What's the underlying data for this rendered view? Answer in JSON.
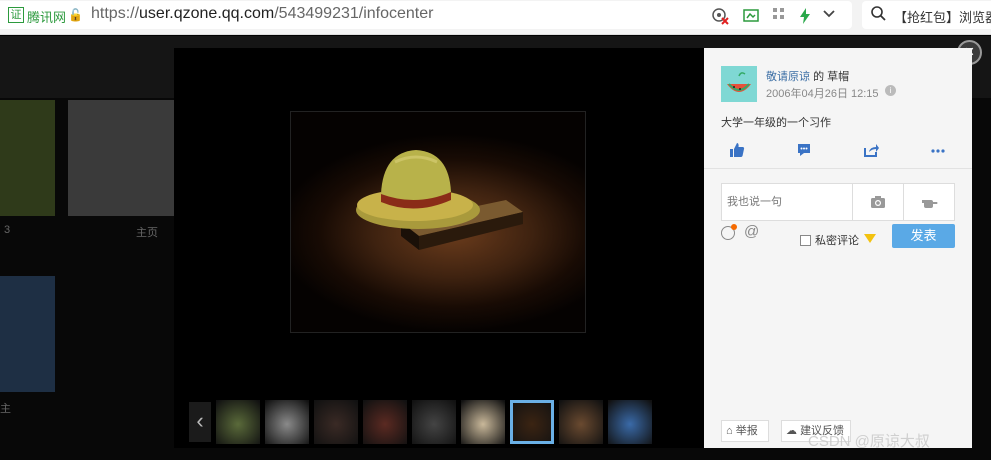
{
  "browser": {
    "cert_label": "腾讯网",
    "url_scheme": "https://",
    "url_host": "user.qzone.qq.com",
    "url_path": "/543499231/infocenter",
    "search_text": "【抢红包】浏览器"
  },
  "background_page": {
    "labels": [
      "3",
      "主页",
      "主"
    ]
  },
  "viewer": {
    "prev_glyph": "‹",
    "thumbnails": [
      {
        "name": "yellow-car",
        "color": "#5a6a3a"
      },
      {
        "name": "robot",
        "color": "#8a8a8a"
      },
      {
        "name": "dark-scene",
        "color": "#3a2a25"
      },
      {
        "name": "creature",
        "color": "#5b2a22"
      },
      {
        "name": "machine",
        "color": "#444444"
      },
      {
        "name": "toy-figures",
        "color": "#c9b89a"
      },
      {
        "name": "straw-hat",
        "color": "#3b2412",
        "active": true
      },
      {
        "name": "cartoon",
        "color": "#6a4a30"
      },
      {
        "name": "ship",
        "color": "#3a6aa8"
      }
    ]
  },
  "panel": {
    "author": "敬请原谅",
    "author_of": "的",
    "album": "草帽",
    "timestamp": "2006年04月26日 12:15",
    "caption": "大学一年级的一个习作",
    "comment_placeholder": "我也说一句",
    "private_label": "私密评论",
    "submit_label": "发表",
    "report_label": "举报",
    "feedback_label": "建议反馈"
  },
  "watermark": "CSDN @原谅大叔"
}
